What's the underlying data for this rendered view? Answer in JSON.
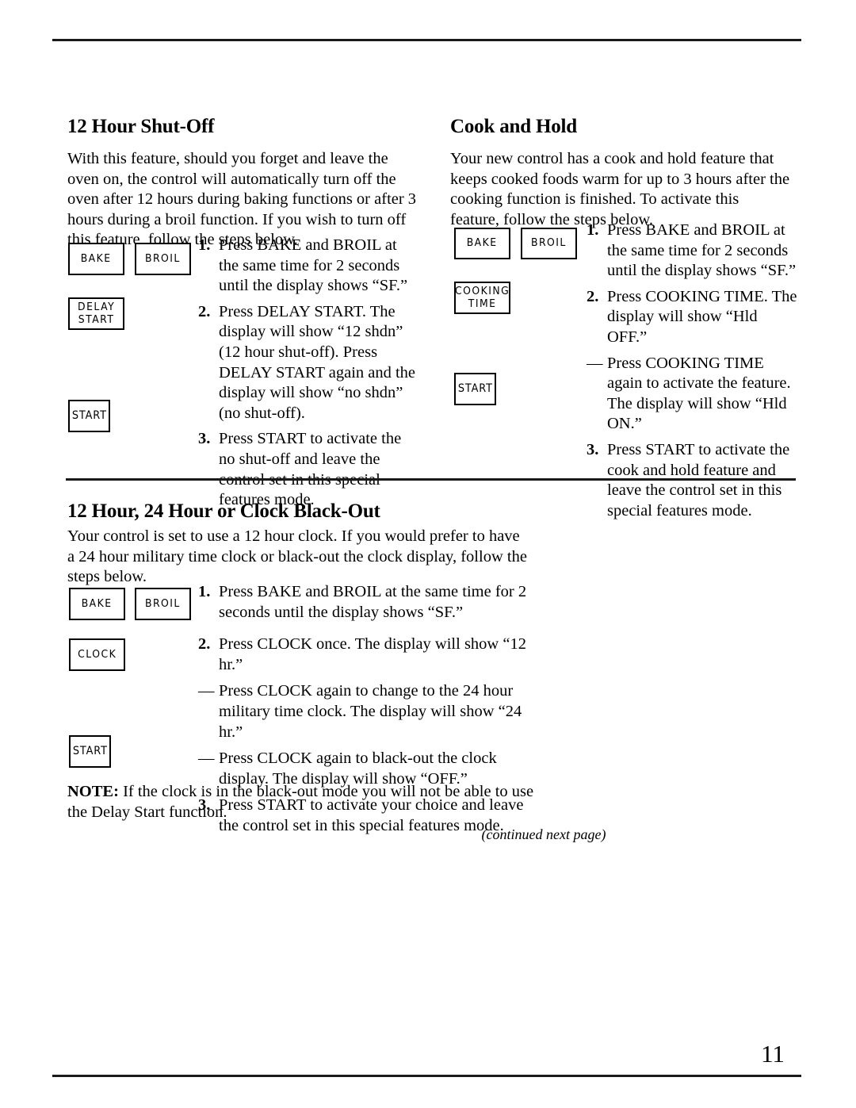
{
  "page": {
    "folio": "11",
    "continued_note": "(continued next page)"
  },
  "sections": {
    "shutoff": {
      "heading": "12 Hour Shut-Off",
      "intro": "With this feature, should you forget and leave the oven on, the control will automatically turn off the oven after 12 hours during baking functions or after 3 hours during a broil function. If you wish to turn off this feature, follow the steps below.",
      "steps": [
        {
          "marker": "1.",
          "text": "Press BAKE and BROIL at the same time for 2 seconds until the display shows “SF.”"
        },
        {
          "marker": "2.",
          "text": "Press DELAY START. The display will show “12 shdn” (12 hour shut-off). Press DELAY START again and the display will show “no shdn” (no shut-off)."
        },
        {
          "marker": "3.",
          "text": "Press START to activate the no shut-off and leave the control set in this special features mode."
        }
      ],
      "buttons": [
        {
          "label": "BAKE"
        },
        {
          "label": "BROIL"
        },
        {
          "label": "DELAY\nSTART"
        },
        {
          "label": "START"
        }
      ]
    },
    "cookhold": {
      "heading": "Cook and Hold",
      "intro": "Your new control has a cook and hold feature that keeps cooked foods warm for up to 3 hours after the cooking function is finished. To activate this feature, follow the steps below.",
      "steps": [
        {
          "marker": "1.",
          "text": "Press BAKE and BROIL at the same time for 2 seconds until the display shows “SF.”"
        },
        {
          "marker": "2.",
          "text": "Press COOKING TIME. The display will show “Hld OFF.”"
        },
        {
          "marker": "—",
          "text": "Press COOKING TIME again to activate the feature. The display will show “Hld ON.”"
        },
        {
          "marker": "3.",
          "text": "Press START to activate the cook and hold feature and leave the control set in this special features mode."
        }
      ],
      "buttons": [
        {
          "label": "BAKE"
        },
        {
          "label": "BROIL"
        },
        {
          "label": "COOKING\nTIME"
        },
        {
          "label": "START"
        }
      ]
    },
    "clock": {
      "heading": "12 Hour, 24 Hour or Clock Black-Out",
      "intro": "Your control is set to use a 12 hour clock. If you would prefer to have a 24 hour military time clock or black-out the clock display, follow the steps below.",
      "steps": [
        {
          "marker": "1.",
          "text": "Press BAKE and BROIL at the same time for 2 seconds until the display shows “SF.”"
        },
        {
          "marker": "2.",
          "text": "Press CLOCK once. The display will show “12 hr.”"
        },
        {
          "marker": "—",
          "text": "Press CLOCK again to change to the 24 hour military time clock. The display will show “24 hr.”"
        },
        {
          "marker": "—",
          "text": "Press CLOCK again to black-out the clock display. The display will show “OFF.”"
        },
        {
          "marker": "3.",
          "text": "Press START to activate your choice and leave the control set in this special features mode."
        }
      ],
      "buttons": [
        {
          "label": "BAKE"
        },
        {
          "label": "BROIL"
        },
        {
          "label": "CLOCK"
        },
        {
          "label": "START"
        }
      ],
      "note_label": "NOTE:",
      "note_text": " If the clock is in the black-out mode you will not be able to use the Delay Start function."
    }
  }
}
